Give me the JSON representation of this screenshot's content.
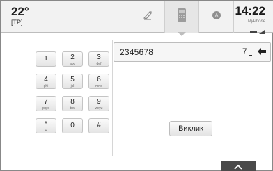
{
  "status": {
    "temperature": "22°",
    "traffic": "[TP]",
    "time": "14:22",
    "device": "MyPhone"
  },
  "tabs": [
    {
      "name": "music",
      "icon": "music-note-icon",
      "active": false
    },
    {
      "name": "phone",
      "icon": "phone-icon",
      "active": true
    },
    {
      "name": "apps",
      "icon": "app-icon",
      "active": false
    }
  ],
  "keypad": {
    "keys": [
      {
        "digit": "1",
        "letters": ""
      },
      {
        "digit": "2",
        "letters": "abc"
      },
      {
        "digit": "3",
        "letters": "def"
      },
      {
        "digit": "4",
        "letters": "ghi"
      },
      {
        "digit": "5",
        "letters": "jkl"
      },
      {
        "digit": "6",
        "letters": "mno"
      },
      {
        "digit": "7",
        "letters": "pqrs"
      },
      {
        "digit": "8",
        "letters": "tuv"
      },
      {
        "digit": "9",
        "letters": "wxyz"
      },
      {
        "digit": "*",
        "letters": "+"
      },
      {
        "digit": "0",
        "letters": ""
      },
      {
        "digit": "#",
        "letters": ""
      }
    ]
  },
  "dial": {
    "number": "2345678",
    "suffix": "7",
    "call_label": "Виклик"
  },
  "colors": {
    "status_bg": "#f2f2f2",
    "active_tab_bg": "#e6e6e6",
    "expand_tab_bg": "#4a4a4a"
  }
}
